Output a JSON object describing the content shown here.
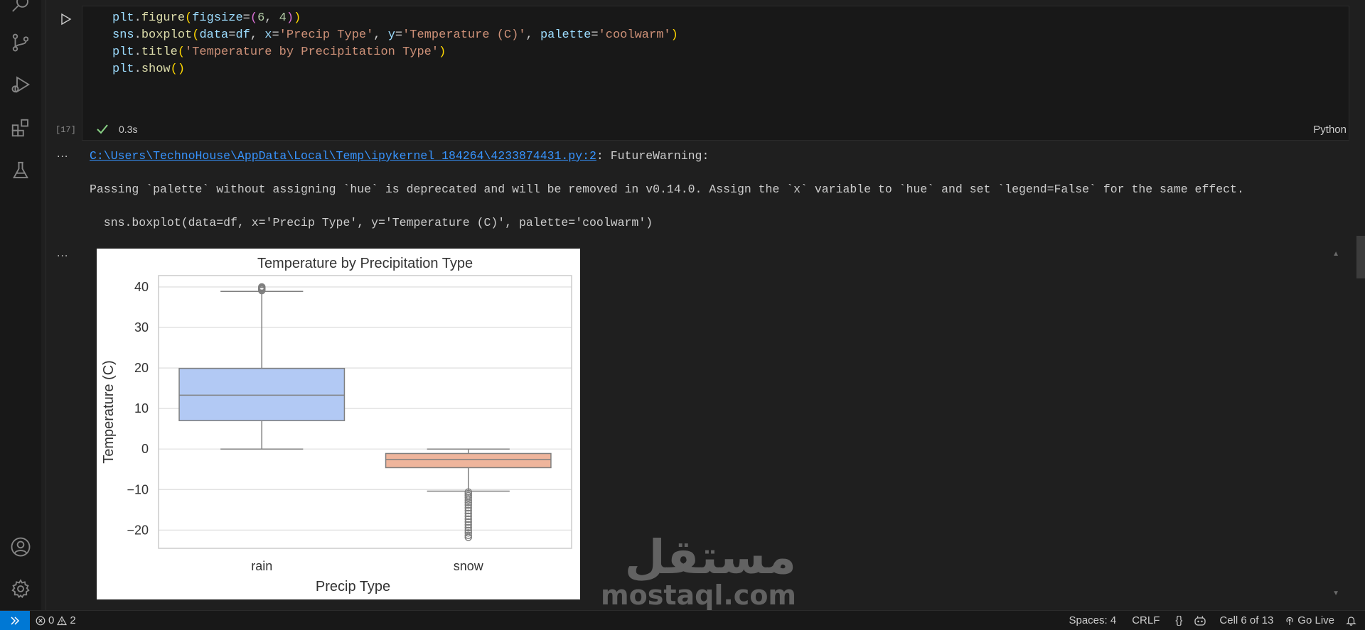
{
  "activity_bar": {
    "icons": [
      "search-icon",
      "source-control-icon",
      "run-debug-icon",
      "extensions-icon",
      "testing-icon",
      "account-icon",
      "settings-gear-icon"
    ]
  },
  "cell": {
    "execution_count": "[17]",
    "code_lines": [
      "plt.figure(figsize=(6, 4))",
      "sns.boxplot(data=df, x='Precip Type', y='Temperature (C)', palette='coolwarm')",
      "plt.title('Temperature by Precipitation Type')",
      "plt.show()"
    ],
    "exec_time": "0.3s",
    "language": "Python"
  },
  "output": {
    "dots": "...",
    "warning_path": "C:\\Users\\TechnoHouse\\AppData\\Local\\Temp\\ipykernel_184264\\4233874431.py:2",
    "warning_label": ": FutureWarning:",
    "warning_message": "Passing `palette` without assigning `hue` is deprecated and will be removed in v0.14.0. Assign the `x` variable to `hue` and set `legend=False` for the same effect.",
    "warning_code": "  sns.boxplot(data=df, x='Precip Type', y='Temperature (C)', palette='coolwarm')"
  },
  "chart_data": {
    "type": "box",
    "title": "Temperature by Precipitation Type",
    "xlabel": "Precip Type",
    "ylabel": "Temperature (C)",
    "ylim": [
      -24.5,
      42.8
    ],
    "yticks": [
      -20,
      -10,
      0,
      10,
      20,
      30,
      40
    ],
    "ytick_labels": [
      "−20",
      "−10",
      "0",
      "10",
      "20",
      "30",
      "40"
    ],
    "grid": true,
    "categories": [
      "rain",
      "snow"
    ],
    "boxes": [
      {
        "name": "rain",
        "whisker_low": 0,
        "q1": 7,
        "median": 13.3,
        "q3": 19.9,
        "whisker_high": 38.9,
        "color": "#b2c9f4",
        "outliers": [
          39.1,
          39.4,
          39.6,
          39.8,
          40.0
        ]
      },
      {
        "name": "snow",
        "whisker_low": -10.4,
        "q1": -4.6,
        "median": -2.6,
        "q3": -1.1,
        "whisker_high": 0,
        "color": "#efb59c",
        "outliers": [
          -10.6,
          -11.0,
          -11.5,
          -12.0,
          -12.6,
          -13.2,
          -13.8,
          -14.5,
          -15.2,
          -15.9,
          -16.6,
          -17.3,
          -18.0,
          -18.7,
          -19.4,
          -20.1,
          -20.7,
          -21.3,
          -21.8
        ]
      }
    ]
  },
  "watermark": {
    "arabic": "مستقل",
    "latin": "mostaql.com"
  },
  "statusbar": {
    "errors": "0",
    "warnings": "2",
    "spaces": "Spaces: 4",
    "eol": "CRLF",
    "braces": "{}",
    "cell_pos": "Cell 6 of 13",
    "go_live": "Go Live"
  }
}
